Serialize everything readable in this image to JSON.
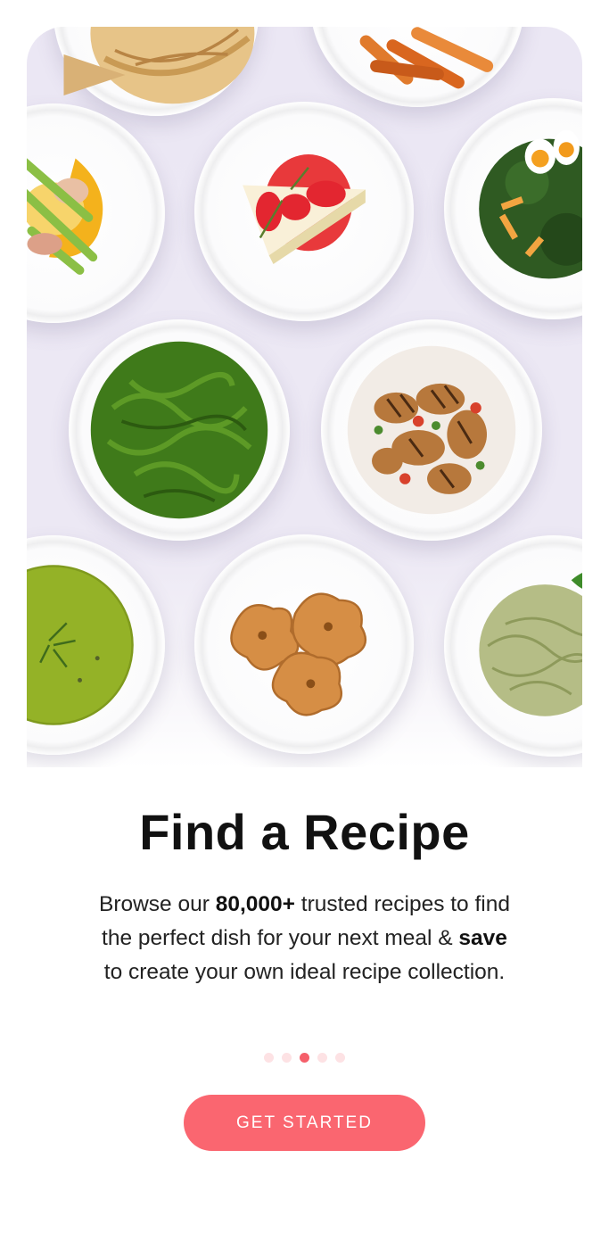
{
  "onboarding": {
    "title": "Find a Recipe",
    "desc_1": "Browse our ",
    "desc_2": "80,000+",
    "desc_3": " trusted recipes to find the perfect dish for your next meal & ",
    "desc_4": "save",
    "desc_5": " to create your own ideal recipe collection.",
    "page_current": 3,
    "page_total": 5,
    "cta_label": "GET STARTED"
  },
  "dishes": [
    "pear-tart",
    "roasted-carrots",
    "asparagus-eggs-benedict",
    "strawberry-cheesecake",
    "kale-egg-salad",
    "green-pesto-pasta",
    "grilled-chicken-salad",
    "pea-soup",
    "butter-cookies",
    "spinach-spaghetti"
  ],
  "colors": {
    "accent": "#fa6670",
    "dot_active": "#f55f6a",
    "dot_inactive": "#fde2e4",
    "hero_bg": "#ebe7f4"
  }
}
